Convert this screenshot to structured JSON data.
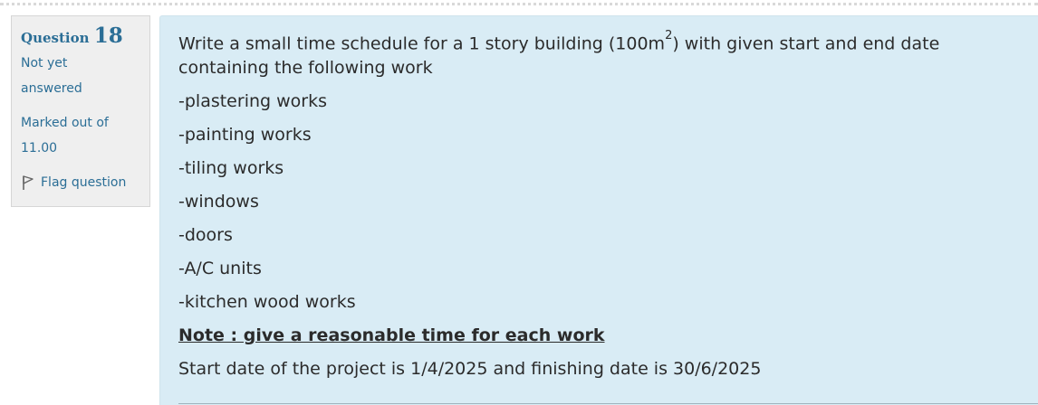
{
  "info": {
    "question_label": "Question",
    "question_number": "18",
    "status_line1": "Not yet",
    "status_line2": "answered",
    "marks_line1": "Marked out of",
    "marks_line2": "11.00",
    "flag_label": "Flag question",
    "flag_icon": "flag-icon"
  },
  "question": {
    "intro_before_sup": "Write a small time schedule for a 1 story building (100m",
    "superscript": "2",
    "intro_after_sup": ") with given start and end date",
    "intro_line2": "containing  the following work",
    "items": [
      "-plastering works",
      "-painting works",
      "-tiling works",
      "-windows",
      "-doors",
      "-A/C units",
      "-kitchen wood works"
    ],
    "note": "Note : give a reasonable time for each work ",
    "dates": "Start date of the project is 1/4/2025 and finishing date is  30/6/2025"
  },
  "colors": {
    "accent": "#2b6e96",
    "panel_bg": "#efefef",
    "content_bg": "#d9ecf5",
    "text": "#2b2b2b"
  }
}
